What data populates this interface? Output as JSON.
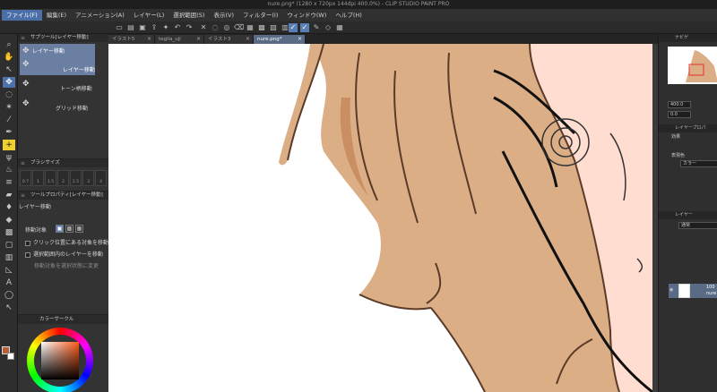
{
  "title": "nure.png* (1280 x 720px 144dpi 400.0%) - CLIP STUDIO PAINT PRO",
  "menu": [
    {
      "label": "ファイル(F)",
      "active": true
    },
    {
      "label": "編集(E)"
    },
    {
      "label": "アニメーション(A)"
    },
    {
      "label": "レイヤー(L)"
    },
    {
      "label": "選択範囲(S)"
    },
    {
      "label": "表示(V)"
    },
    {
      "label": "フィルター(I)"
    },
    {
      "label": "ウィンドウ(W)"
    },
    {
      "label": "ヘルプ(H)"
    }
  ],
  "tabs": [
    {
      "label": "イラスト5"
    },
    {
      "label": "tegila_uji"
    },
    {
      "label": "イラスト3"
    },
    {
      "label": "nure.png*",
      "active": true
    }
  ],
  "subtool_panel": {
    "header": "サブツール[レイヤー移動]",
    "items": [
      {
        "label": "レイヤー移動",
        "selected": true
      },
      {
        "label": "レイヤー移動"
      },
      {
        "label": "トーン柄移動"
      },
      {
        "label": "グリッド移動"
      }
    ]
  },
  "brush_size": {
    "header": "ブラシサイズ",
    "cells": [
      "0.7",
      "1",
      "1.5",
      "2",
      "2.5",
      "3",
      "4"
    ]
  },
  "tool_property": {
    "header": "ツールプロパティ[レイヤー移動]",
    "tool_name": "レイヤー移動",
    "target_label": "移動対象",
    "options": [
      "クリック位置にある対象を移動",
      "選択範囲内のレイヤーを移動",
      "移動対象を選択状態に変更"
    ]
  },
  "color_panel": {
    "header": "カラーサークル"
  },
  "right_panel": {
    "navigator_tab": "ナビゲ",
    "zoom": "400.0",
    "rotation": "0.0",
    "layer_property_tab": "レイヤープロパ",
    "effect_label": "効果",
    "expression_label": "表現色",
    "expression_value": "カラー",
    "layer_tab": "レイヤー",
    "blend_mode": "通常",
    "layer_opacity": "100",
    "layer_name": "nure"
  },
  "colors": {
    "accent": "#4a6fa8",
    "main_color": "#b5603a",
    "sub_color": "#ffffff",
    "hair": "#dcae85",
    "skin": "#ffddd0"
  }
}
